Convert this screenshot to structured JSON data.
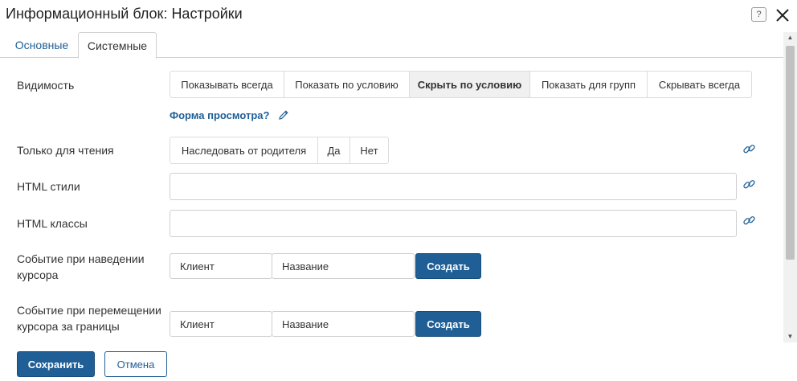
{
  "dialog": {
    "title": "Информационный блок: Настройки",
    "help_icon": "help-icon",
    "close_icon": "close-icon"
  },
  "tabs": [
    {
      "label": "Основные",
      "active": false
    },
    {
      "label": "Системные",
      "active": true
    }
  ],
  "visibility": {
    "label": "Видимость",
    "options": [
      "Показывать всегда",
      "Показать по условию",
      "Скрыть по условию",
      "Показать для групп",
      "Скрывать всегда"
    ],
    "selected": "Скрыть по условию",
    "view_form_link": "Форма просмотра?"
  },
  "readonly": {
    "label": "Только для чтения",
    "options": [
      "Наследовать от родителя",
      "Да",
      "Нет"
    ]
  },
  "html_styles": {
    "label": "HTML стили",
    "value": ""
  },
  "html_classes": {
    "label": "HTML классы",
    "value": ""
  },
  "hover_event": {
    "label": "Событие при наведении курсора",
    "type_value": "Клиент",
    "name_value": "Название",
    "create_label": "Создать"
  },
  "boundary_event": {
    "label": "Событие при перемещении курсора за границы",
    "type_value": "Клиент",
    "name_value": "Название",
    "create_label": "Создать"
  },
  "footer": {
    "save_label": "Сохранить",
    "cancel_label": "Отмена"
  },
  "colors": {
    "accent": "#1f5f96",
    "active_segment": "#f0f0f0",
    "border": "#dcdcdc"
  }
}
